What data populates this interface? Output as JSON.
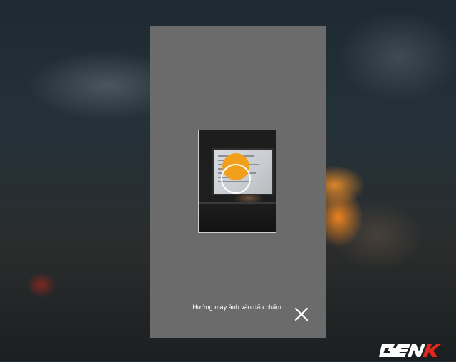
{
  "camera": {
    "instruction": "Hướng máy ảnh vào dấu chấm",
    "close_icon": "close-icon",
    "target_color": "#f0a01a"
  },
  "watermark": {
    "logo_text": "GENK",
    "icon": "genk-logo"
  }
}
